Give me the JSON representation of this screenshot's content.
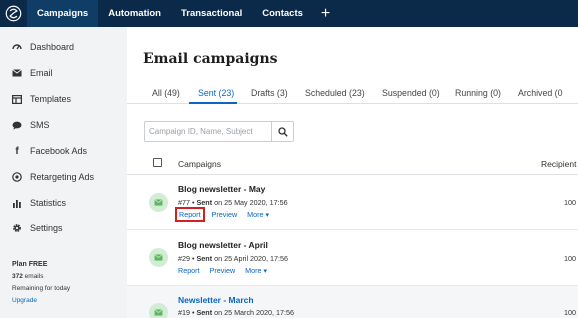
{
  "topnav": {
    "tabs": [
      {
        "label": "Campaigns",
        "active": true
      },
      {
        "label": "Automation"
      },
      {
        "label": "Transactional"
      },
      {
        "label": "Contacts"
      }
    ],
    "add_label": "+"
  },
  "sidebar": {
    "items": [
      {
        "label": "Dashboard",
        "icon": "dashboard-icon"
      },
      {
        "label": "Email",
        "icon": "email-icon"
      },
      {
        "label": "Templates",
        "icon": "templates-icon"
      },
      {
        "label": "SMS",
        "icon": "sms-icon"
      },
      {
        "label": "Facebook Ads",
        "icon": "facebook-icon"
      },
      {
        "label": "Retargeting Ads",
        "icon": "retargeting-icon"
      },
      {
        "label": "Statistics",
        "icon": "statistics-icon"
      },
      {
        "label": "Settings",
        "icon": "settings-icon"
      }
    ],
    "plan": {
      "title": "Plan FREE",
      "emails_count": "372",
      "emails_word": " emails",
      "remaining": "Remaining for today",
      "upgrade": "Upgrade"
    }
  },
  "main": {
    "title": "Email campaigns",
    "tabs": [
      {
        "label": "All (49)"
      },
      {
        "label": "Sent (23)",
        "active": true
      },
      {
        "label": "Drafts (3)"
      },
      {
        "label": "Scheduled (23)"
      },
      {
        "label": "Suspended (0)"
      },
      {
        "label": "Running (0)"
      },
      {
        "label": "Archived (0"
      }
    ],
    "search": {
      "placeholder": "Campaign ID, Name, Subject",
      "value": ""
    },
    "columns": {
      "campaigns": "Campaigns",
      "recipients": "Recipient"
    },
    "rows": [
      {
        "title": "Blog newsletter - May",
        "id": "#77",
        "sep": " • ",
        "status": "Sent",
        "date": " on 25 May 2020, 17:56",
        "recipients": "100",
        "report": "Report",
        "preview": "Preview",
        "more": "More"
      },
      {
        "title": "Blog newsletter - April",
        "id": "#29",
        "sep": " • ",
        "status": "Sent",
        "date": " on 25 April 2020, 17:56",
        "recipients": "100",
        "report": "Report",
        "preview": "Preview",
        "more": "More"
      },
      {
        "title": "Newsletter - March",
        "id": "#19",
        "sep": " • ",
        "status": "Sent",
        "date": " on 25 March 2020, 17:56",
        "recipients": "100"
      }
    ]
  },
  "colors": {
    "nav_bg": "#0b2a4a",
    "accent": "#0a66c2",
    "highlight": "#d32020",
    "sent_green": "#5cb85c"
  }
}
